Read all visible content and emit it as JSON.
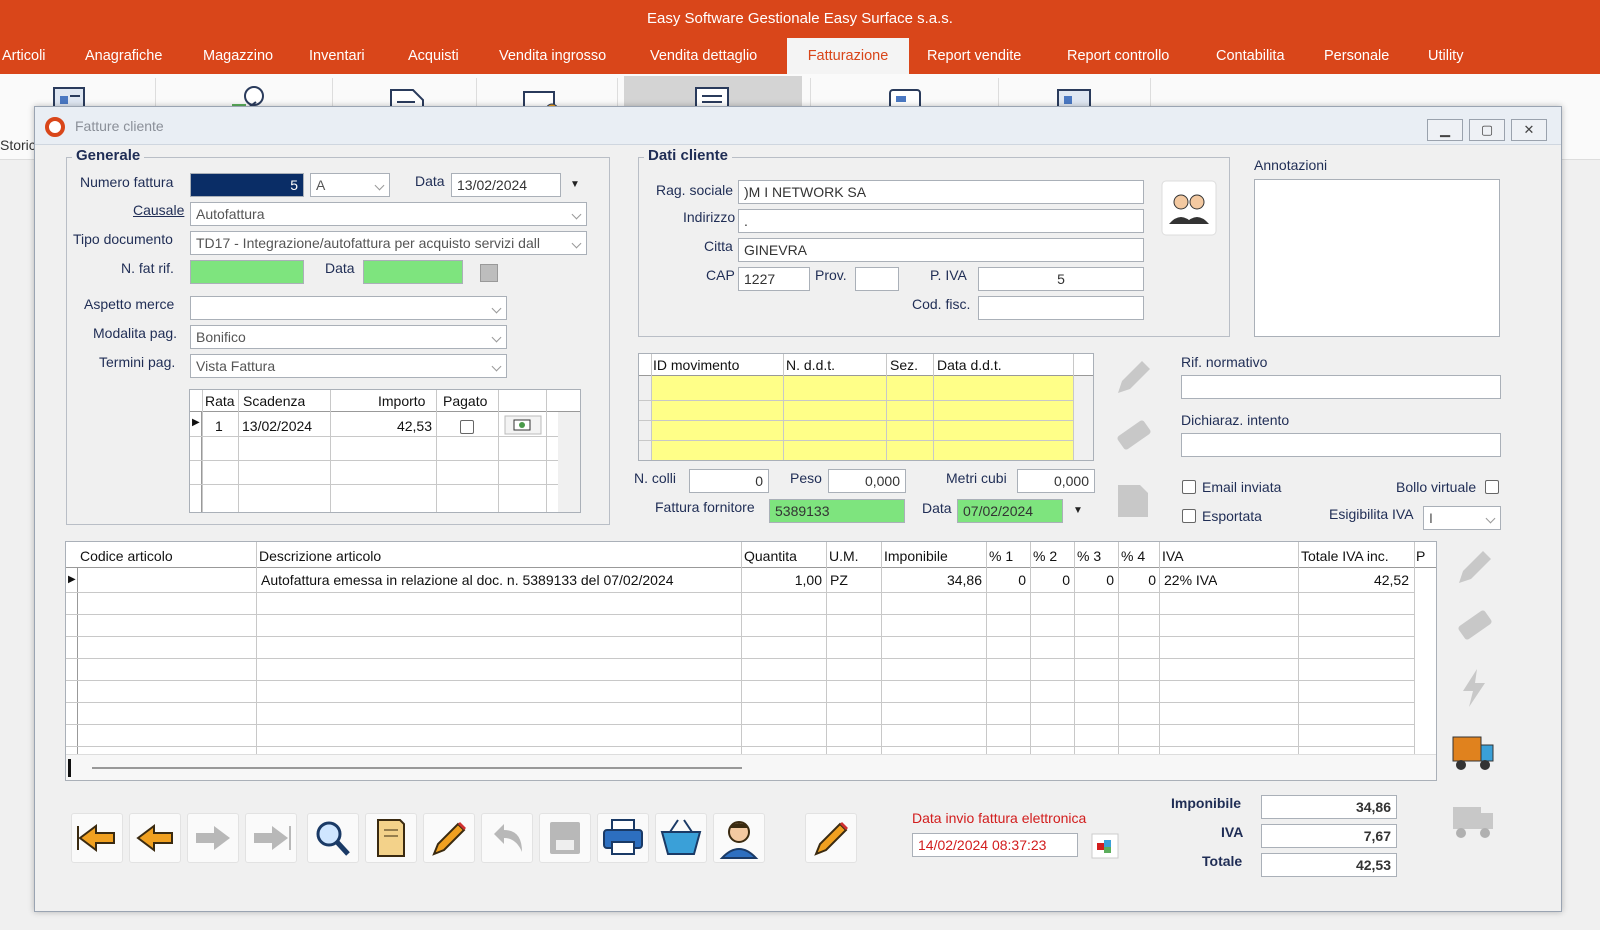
{
  "app": {
    "title": "Easy Software Gestionale Easy Surface s.a.s."
  },
  "menu": [
    {
      "label": "Articoli"
    },
    {
      "label": "Anagrafiche"
    },
    {
      "label": "Magazzino"
    },
    {
      "label": "Inventari"
    },
    {
      "label": "Acquisti"
    },
    {
      "label": "Vendita ingrosso"
    },
    {
      "label": "Vendita dettaglio"
    },
    {
      "label": "Fatturazione"
    },
    {
      "label": "Report vendite"
    },
    {
      "label": "Report controllo"
    },
    {
      "label": "Contabilita"
    },
    {
      "label": "Personale"
    },
    {
      "label": "Utility"
    }
  ],
  "ribbon": {
    "storico_label": "Storic"
  },
  "window": {
    "title": "Fatture cliente"
  },
  "generale": {
    "title": "Generale",
    "numero_label": "Numero fattura",
    "numero_value": "5",
    "serie_value": "A",
    "data_label": "Data",
    "data_value": "13/02/2024",
    "causale_label": "Causale",
    "causale_value": "Autofattura",
    "tipo_label": "Tipo documento",
    "tipo_value": "TD17 - Integrazione/autofattura per acquisto servizi dall",
    "nfat_label": "N. fat rif.",
    "nfat_value": "",
    "datarif_label": "Data",
    "datarif_value": "",
    "aspetto_label": "Aspetto merce",
    "aspetto_value": "",
    "modalita_label": "Modalita pag.",
    "modalita_value": "Bonifico",
    "termini_label": "Termini pag.",
    "termini_value": "Vista Fattura"
  },
  "rate": {
    "headers": [
      "Rata",
      "Scadenza",
      "Importo",
      "Pagato"
    ],
    "rows": [
      {
        "rata": "1",
        "scadenza": "13/02/2024",
        "importo": "42,53",
        "pagato": false
      }
    ]
  },
  "cliente": {
    "title": "Dati cliente",
    "rag_label": "Rag. sociale",
    "rag_value": ")M  I   NETWORK SA",
    "ind_label": "Indirizzo",
    "ind_value": ".",
    "citta_label": "Citta",
    "citta_value": "GINEVRA",
    "cap_label": "CAP",
    "cap_value": "1227",
    "prov_label": "Prov.",
    "prov_value": "",
    "piva_label": "P. IVA",
    "piva_value": "5",
    "codfisc_label": "Cod. fisc.",
    "codfisc_value": ""
  },
  "annotazioni": {
    "label": "Annotazioni",
    "value": ""
  },
  "ddt": {
    "headers": [
      "ID movimento",
      "N. d.d.t.",
      "Sez.",
      "Data d.d.t."
    ]
  },
  "colli": {
    "ncolli_label": "N. colli",
    "ncolli_value": "0",
    "peso_label": "Peso",
    "peso_value": "0,000",
    "metri_label": "Metri cubi",
    "metri_value": "0,000"
  },
  "fornitore": {
    "label": "Fattura fornitore",
    "value": "5389133",
    "data_label": "Data",
    "data_value": "07/02/2024"
  },
  "rif": {
    "normativo_label": "Rif. normativo",
    "normativo_value": "",
    "intento_label": "Dichiaraz. intento",
    "intento_value": ""
  },
  "flags": {
    "email_label": "Email inviata",
    "email": false,
    "bollo_label": "Bollo virtuale",
    "bollo": false,
    "esportata_label": "Esportata",
    "esportata": false,
    "esigibilita_label": "Esigibilita IVA",
    "esigibilita_value": "I"
  },
  "articoli": {
    "headers": [
      "Codice articolo",
      "Descrizione articolo",
      "Quantita",
      "U.M.",
      "Imponibile",
      "% 1",
      "% 2",
      "% 3",
      "% 4",
      "IVA",
      "Totale IVA inc.",
      "P"
    ],
    "rows": [
      {
        "codice": "",
        "descrizione": "Autofattura emessa in relazione al doc. n. 5389133 del 07/02/2024",
        "quantita": "1,00",
        "um": "PZ",
        "imponibile": "34,86",
        "p1": "0",
        "p2": "0",
        "p3": "0",
        "p4": "0",
        "iva": "22% IVA",
        "totale": "42,52"
      }
    ]
  },
  "invio": {
    "label": "Data invio fattura elettronica",
    "value": "14/02/2024 08:37:23"
  },
  "totali": {
    "imponibile_label": "Imponibile",
    "imponibile_value": "34,86",
    "iva_label": "IVA",
    "iva_value": "7,67",
    "totale_label": "Totale",
    "totale_value": "42,53"
  },
  "toolbar_icons": [
    "first-icon",
    "prev-icon",
    "next-icon",
    "last-icon",
    "search-icon",
    "new-document-icon",
    "edit-pencil-icon",
    "undo-icon",
    "save-icon",
    "print-icon",
    "basket-icon",
    "user-icon"
  ],
  "colors": {
    "brand": "#d9461a",
    "field_green": "#7ee47e",
    "grid_yellow": "#ffff88",
    "alert_red": "#d21d1d"
  }
}
